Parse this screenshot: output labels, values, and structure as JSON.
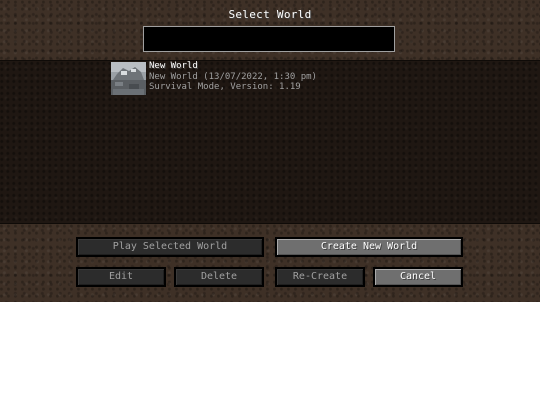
{
  "screen": {
    "title": "Select World",
    "search_value": ""
  },
  "worlds": [
    {
      "name": "New World",
      "details": "New World (13/07/2022, 1:30 pm)",
      "mode": "Survival Mode, Version: 1.19"
    }
  ],
  "buttons": {
    "play": "Play Selected World",
    "create": "Create New World",
    "edit": "Edit",
    "delete": "Delete",
    "recreate": "Re-Create",
    "cancel": "Cancel"
  },
  "colors": {
    "dirt_background": "#3e3026",
    "list_background": "#1f1712",
    "button": "#6f6f6f",
    "button_disabled": "#2c2c2c",
    "text": "#ffffff",
    "text_muted": "#a0a0a0"
  }
}
